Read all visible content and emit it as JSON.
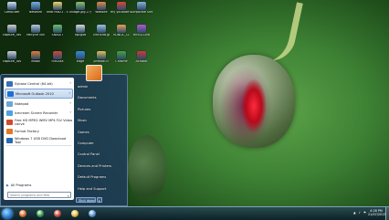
{
  "desktop": {
    "icons": [
      {
        "label": "Computer"
      },
      {
        "label": "Network"
      },
      {
        "label": "infor.md21 - Shortcut"
      },
      {
        "label": "village.jpg 27/05/13"
      },
      {
        "label": "website"
      },
      {
        "label": "my youtube collection"
      },
      {
        "label": "Corporate Site"
      },
      {
        "label": "capture_Tos"
      },
      {
        "label": "Recycle Bin"
      },
      {
        "label": "SNAGIT"
      },
      {
        "label": "hpcgsd"
      },
      {
        "label": "vincicdd.jp"
      },
      {
        "label": "VDNDC_CL"
      },
      {
        "label": "tntlSG.Dvd"
      },
      {
        "label": "capture_Tos"
      },
      {
        "label": "install"
      },
      {
        "label": "FileZilla"
      },
      {
        "label": "edge"
      },
      {
        "label": "pnmodu.F"
      },
      {
        "label": "Chrome"
      },
      {
        "label": "Acrobat"
      },
      {
        "label": "Windows 7 DVD"
      }
    ]
  },
  "start_menu": {
    "programs": [
      {
        "label": "Sybase Central (64-bit)",
        "has_submenu": true,
        "selected": false,
        "color": "#3a6fb0"
      },
      {
        "label": "Microsoft Outlook 2010",
        "has_submenu": true,
        "selected": true,
        "color": "#1f6fd1"
      },
      {
        "label": "Notepad",
        "has_submenu": true,
        "selected": false,
        "color": "#6aa6d8"
      },
      {
        "label": "Icecream Screen Recorder",
        "has_submenu": true,
        "selected": false,
        "color": "#4aa3e0"
      },
      {
        "label": "Free HD MPEG WMV MP4 FLV Video conve",
        "has_submenu": false,
        "selected": false,
        "color": "#d24a2a"
      },
      {
        "label": "Format Factory",
        "has_submenu": false,
        "selected": false,
        "color": "#e07a2a"
      },
      {
        "label": "Windows 7 USB DVD Download Tool",
        "has_submenu": false,
        "selected": false,
        "color": "#2a6ab0"
      }
    ],
    "all_programs_label": "All Programs",
    "search_placeholder": "Search programs and files",
    "right_items": [
      "admin",
      "Documents",
      "Pictures",
      "Music",
      "Games",
      "Computer",
      "Control Panel",
      "Devices and Printers",
      "Default Programs",
      "Help and Support"
    ],
    "shutdown_label": "Shut down"
  },
  "taskbar": {
    "pinned": [
      {
        "name": "firefox",
        "color": "#e8742a"
      },
      {
        "name": "chrome",
        "color": "#3aa04a"
      },
      {
        "name": "chrome-alt",
        "color": "#d04a3a"
      },
      {
        "name": "explorer",
        "color": "#e8c04a"
      },
      {
        "name": "media",
        "color": "#5a9ad8"
      }
    ],
    "tray_icons": "▲ ♪ ⚑",
    "time": "4:28 PM",
    "date": "21/07/2013"
  }
}
